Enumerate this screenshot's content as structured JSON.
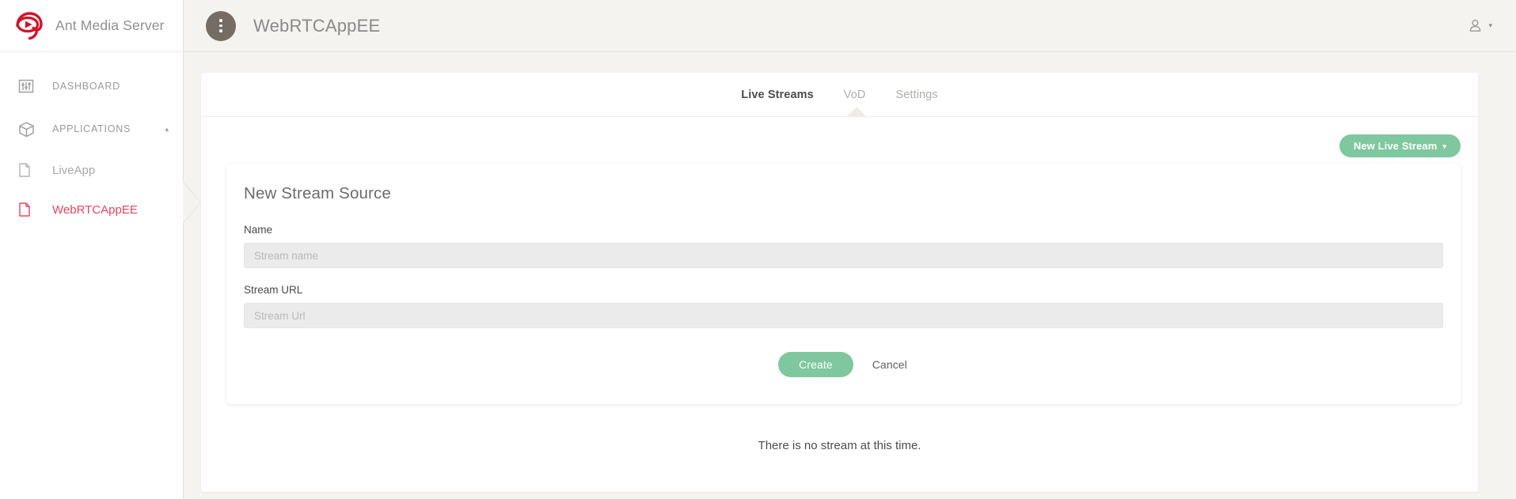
{
  "brand": {
    "name": "Ant Media Server",
    "logo_icon": "ant-media-logo-icon"
  },
  "sidebar": {
    "items": [
      {
        "label": "DASHBOARD",
        "icon": "sliders-icon",
        "active": false
      },
      {
        "label": "APPLICATIONS",
        "icon": "box-icon",
        "caret": "▴",
        "active": false
      }
    ],
    "applications": [
      {
        "label": "LiveApp",
        "icon": "file-icon",
        "active": false
      },
      {
        "label": "WebRTCAppEE",
        "icon": "file-icon",
        "active": true
      }
    ]
  },
  "topbar": {
    "menu_icon": "kebab-menu-icon",
    "title": "WebRTCAppEE",
    "user_icon": "user-icon",
    "user_caret": "▾"
  },
  "tabs": [
    {
      "label": "Live Streams",
      "active": true
    },
    {
      "label": "VoD",
      "active": false
    },
    {
      "label": "Settings",
      "active": false
    }
  ],
  "actions": {
    "new_live_stream": "New Live Stream",
    "new_live_stream_caret": "▾"
  },
  "form": {
    "title": "New Stream Source",
    "name_label": "Name",
    "name_placeholder": "Stream name",
    "name_value": "",
    "url_label": "Stream URL",
    "url_placeholder": "Stream Url",
    "url_value": "",
    "create_label": "Create",
    "cancel_label": "Cancel"
  },
  "empty_state": {
    "message": "There is no stream at this time."
  },
  "colors": {
    "accent_green": "#7fc79e",
    "active_red": "#e8455f",
    "brand_red": "#d3122a",
    "page_bg": "#f4f3f0",
    "kebab_bg": "#756d63"
  }
}
